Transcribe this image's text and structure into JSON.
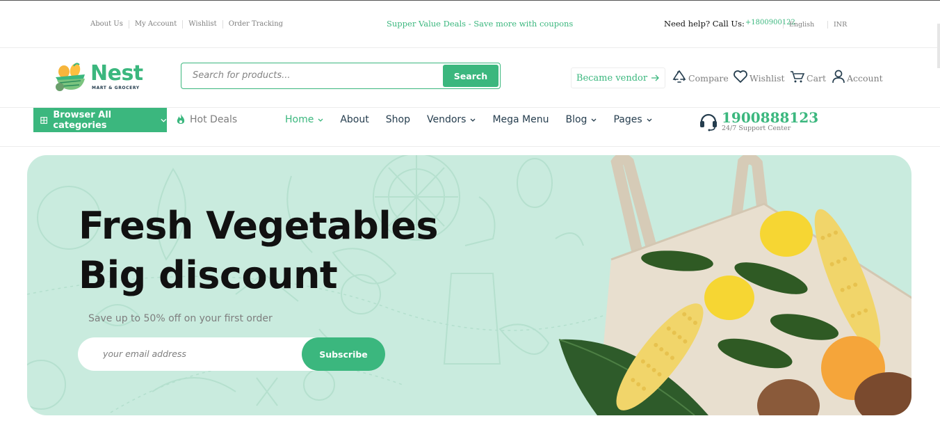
{
  "topbar": {
    "links": [
      "About Us",
      "My Account",
      "Wishlist",
      "Order Tracking"
    ],
    "promo": "Supper Value Deals - Save more with coupons",
    "help_label": "Need help? Call Us:",
    "help_phone": "+1800900122",
    "language": "English",
    "currency": "INR"
  },
  "header": {
    "logo_name": "Nest",
    "logo_tagline": "MART & GROCERY",
    "search_placeholder": "Search for products...",
    "search_button": "Search",
    "vendor_button": "Became vendor",
    "compare": "Compare",
    "wishlist": "Wishlist",
    "cart": "Cart",
    "account": "Account"
  },
  "nav": {
    "categories_button": "Browser All categories",
    "hot_deals": "Hot Deals",
    "menu": [
      {
        "label": "Home",
        "dropdown": true,
        "active": true
      },
      {
        "label": "About",
        "dropdown": false
      },
      {
        "label": "Shop",
        "dropdown": false
      },
      {
        "label": "Vendors",
        "dropdown": true
      },
      {
        "label": "Mega Menu",
        "dropdown": false
      },
      {
        "label": "Blog",
        "dropdown": true
      },
      {
        "label": "Pages",
        "dropdown": true
      }
    ],
    "support_number": "1900888123",
    "support_label": "24/7 Support Center"
  },
  "hero": {
    "title_line1": "Fresh Vegetables",
    "title_line2": "Big discount",
    "subtitle": "Save up to 50% off on your first order",
    "email_placeholder": "your email address",
    "subscribe_button": "Subscribe"
  },
  "colors": {
    "brand": "#3bb77e",
    "hero_bg": "#c9ebde",
    "text_dark": "#253d4e",
    "text_muted": "#7e7e7e"
  },
  "icons": [
    "grid-icon",
    "flame-icon",
    "chevron-down-icon",
    "arrow-right-icon",
    "compare-icon",
    "heart-icon",
    "cart-icon",
    "user-icon",
    "headset-icon"
  ]
}
